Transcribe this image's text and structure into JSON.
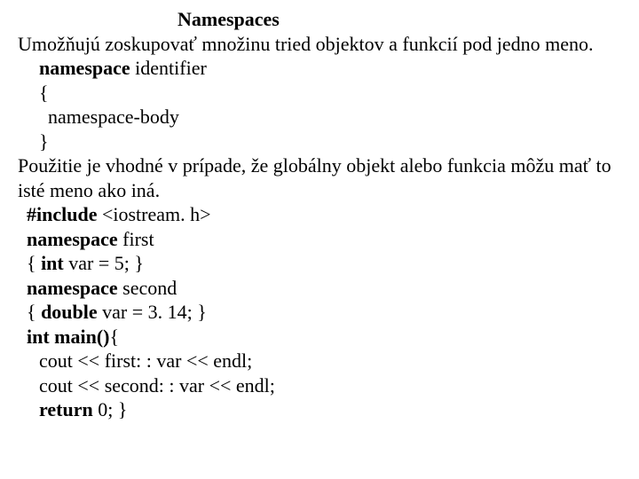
{
  "title": "Namespaces",
  "p1": "Umožňujú zoskupovať množinu tried objektov a funkcií pod jedno meno.",
  "syn": {
    "kw": "namespace",
    "ident": " identifier",
    "lbrace": "{",
    "body": "namespace-body",
    "rbrace": "}"
  },
  "p2": "Použitie je vhodné v prípade, že globálny objekt alebo funkcia môžu mať to isté meno ako iná.",
  "code": {
    "include_kw": "#include",
    "include_arg": " <iostream. h>",
    "ns1_kw": "namespace",
    "ns1_name": " first",
    "ns1_body_a": "{ ",
    "ns1_body_b": "int",
    "ns1_body_c": " var = 5; }",
    "ns2_kw": "namespace",
    "ns2_name": " second",
    "ns2_body_a": "{ ",
    "ns2_body_b": "double",
    "ns2_body_c": " var = 3. 14; }",
    "main_sig_a": "int main()",
    "main_sig_b": "{",
    "l1": "cout << first: : var << endl;",
    "l2": "cout << second: : var << endl;",
    "l3_a": "return",
    "l3_b": " 0; }"
  }
}
